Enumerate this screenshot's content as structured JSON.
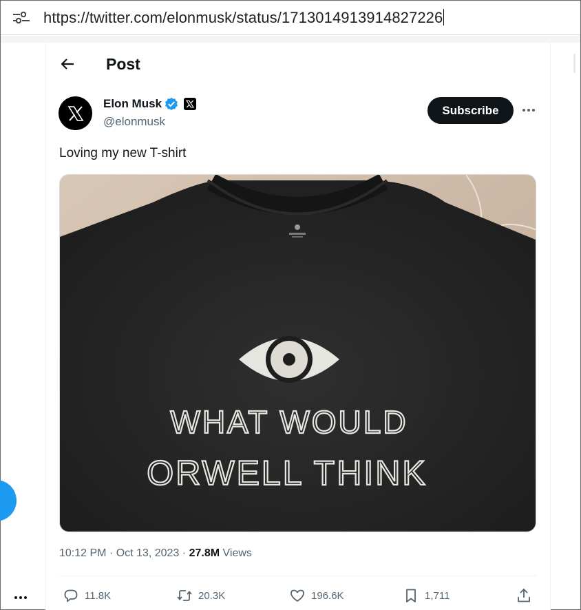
{
  "browser": {
    "url": "https://twitter.com/elonmusk/status/1713014913914827226",
    "address_icon": "site-info-tune-icon"
  },
  "header": {
    "back_icon": "arrow-left-icon",
    "title": "Post"
  },
  "author": {
    "name": "Elon Musk",
    "handle": "@elonmusk",
    "verified_icon": "verified-badge-icon",
    "affiliation_icon": "x-logo-icon",
    "avatar_icon": "x-logo-icon"
  },
  "actions_top": {
    "subscribe_label": "Subscribe",
    "more_icon": "more-horizontal-icon"
  },
  "tweet": {
    "text": "Loving my new T-shirt",
    "image_text_line1": "WHAT WOULD",
    "image_text_line2": "ORWELL THINK",
    "time": "10:12 PM",
    "separator1": "·",
    "date": "Oct 13, 2023",
    "separator2": "·",
    "views_count": "27.8M",
    "views_label": "Views"
  },
  "stats": {
    "replies": "11.8K",
    "reposts": "20.3K",
    "likes": "196.6K",
    "bookmarks": "1,711"
  },
  "colors": {
    "accent": "#1d9bf0",
    "text": "#0f1419",
    "muted": "#536471",
    "button_dark": "#0f1419"
  }
}
